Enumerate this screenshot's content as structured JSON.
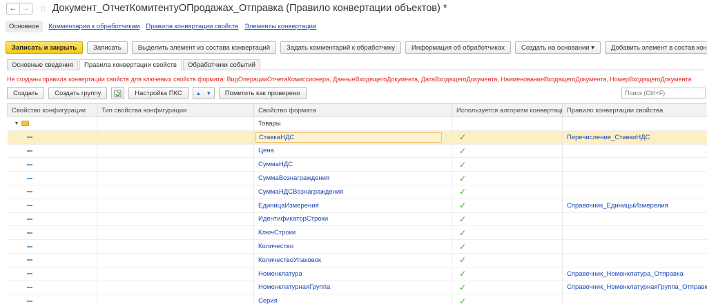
{
  "window": {
    "title": "Документ_ОтчетКомитентуОПродажах_Отправка (Правило конвертации объектов) *",
    "back_icon": "←",
    "forward_icon": "→",
    "star_icon": "☆"
  },
  "nav": {
    "active": "Основное",
    "links": [
      "Комментарии к обработчикам",
      "Правила конвертации свойств",
      "Элементы конвертации"
    ]
  },
  "toolbar": {
    "save_close": "Записать и закрыть",
    "save": "Записать",
    "exclude": "Выделить элемент из состава конвертаций",
    "add_comment": "Задать комментарий к обработчику",
    "handler_info": "Информация об обработчиках",
    "create_based": "Создать на основании ▾",
    "add_element": "Добавить элемент в состав конвертации"
  },
  "tabs": [
    "Основные сведения",
    "Правила конвертации свойств",
    "Обработчики событий"
  ],
  "warning": "Не созданы правила конвертации свойств для ключевых свойств формата: ВидОперацииОтчетаКомиссионера, ДанныеВходящегоДокумента, ДатаВходящегоДокумента, НаименованиеВходящегоДокумента, НомерВходящегоДокумента",
  "table_toolbar": {
    "create": "Создать",
    "create_group": "Создать группу",
    "pks_settings": "Настройка ПКС",
    "mark_checked": "Пометить как проверено",
    "search_placeholder": "Поиск (Ctrl+F)"
  },
  "columns": [
    "Свойство конфигурации",
    "Тип свойства конфигурации",
    "Свойство формата",
    "Используется алгоритм конвертации",
    "Правило конвертации свойства"
  ],
  "group_row": {
    "format_prop": "Товары"
  },
  "rows": [
    {
      "format_prop": "СтавкаНДС",
      "check": "✓",
      "rule": "Перечисление_СтавкиНДС"
    },
    {
      "format_prop": "Цена",
      "check": "✓",
      "rule": ""
    },
    {
      "format_prop": "СуммаНДС",
      "check": "✓",
      "rule": ""
    },
    {
      "format_prop": "СуммаВознаграждения",
      "check": "✓",
      "rule": ""
    },
    {
      "format_prop": "СуммаНДСВознаграждения",
      "check": "✓",
      "rule": ""
    },
    {
      "format_prop": "ЕдиницаИзмерения",
      "check": "✓",
      "rule": "Справочник_ЕдиницыИзмерения"
    },
    {
      "format_prop": "ИдентификаторСтроки",
      "check": "✓",
      "rule": ""
    },
    {
      "format_prop": "КлючСтроки",
      "check": "✓",
      "rule": ""
    },
    {
      "format_prop": "Количество",
      "check": "✓",
      "rule": ""
    },
    {
      "format_prop": "КоличествоУпаковок",
      "check": "✓",
      "rule": ""
    },
    {
      "format_prop": "Номенклатура",
      "check": "✓",
      "rule": "Справочник_Номенклатура_Отправка"
    },
    {
      "format_prop": "НоменклатурнаяГруппа",
      "check": "✓",
      "rule": "Справочник_НоменклатурнаяГруппа_Отправка"
    },
    {
      "format_prop": "Серия",
      "check": "✓",
      "rule": ""
    }
  ]
}
